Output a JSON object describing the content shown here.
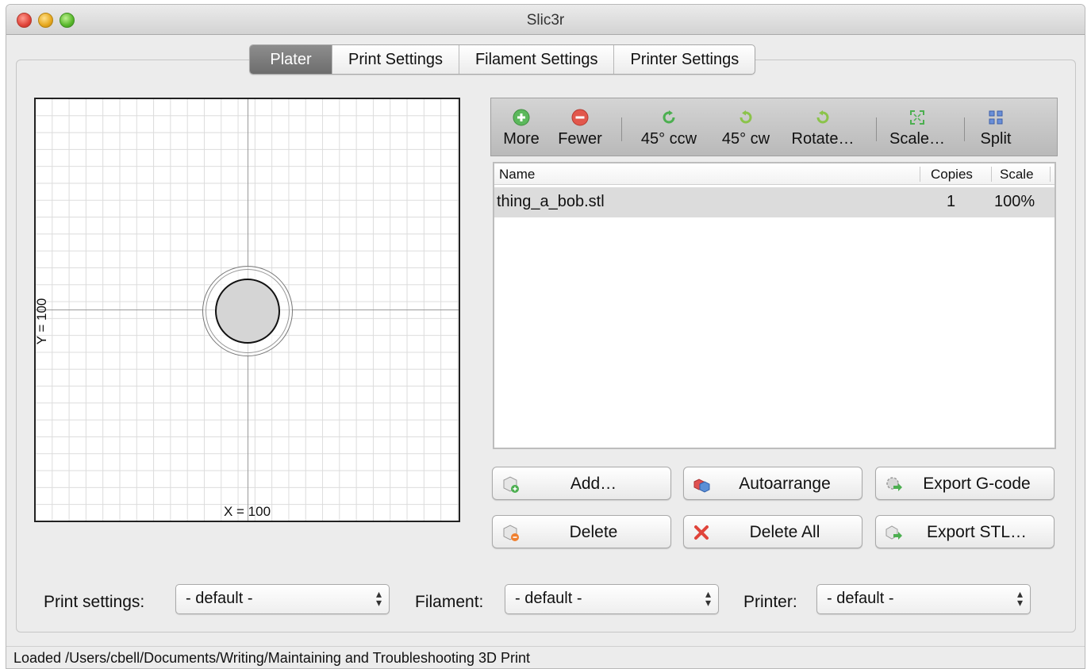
{
  "window": {
    "title": "Slic3r"
  },
  "tabs": [
    {
      "label": "Plater",
      "active": true
    },
    {
      "label": "Print Settings",
      "active": false
    },
    {
      "label": "Filament Settings",
      "active": false
    },
    {
      "label": "Printer Settings",
      "active": false
    }
  ],
  "plater": {
    "x_label": "X = 100",
    "y_label": "Y = 100"
  },
  "toolbar": {
    "more": "More",
    "fewer": "Fewer",
    "rotate_ccw": "45° ccw",
    "rotate_cw": "45° cw",
    "rotate": "Rotate…",
    "scale": "Scale…",
    "split": "Split"
  },
  "object_list": {
    "columns": {
      "name": "Name",
      "copies": "Copies",
      "scale": "Scale"
    },
    "rows": [
      {
        "name": "thing_a_bob.stl",
        "copies": "1",
        "scale": "100%"
      }
    ]
  },
  "buttons": {
    "add": "Add…",
    "autoarrange": "Autoarrange",
    "export_gcode": "Export G-code",
    "delete": "Delete",
    "delete_all": "Delete All",
    "export_stl": "Export STL…"
  },
  "presets": {
    "print_label": "Print settings:",
    "print_value": "- default -",
    "filament_label": "Filament:",
    "filament_value": "- default -",
    "printer_label": "Printer:",
    "printer_value": "- default -"
  },
  "status": {
    "text": "Loaded /Users/cbell/Documents/Writing/Maintaining and Troubleshooting 3D Print"
  },
  "colors": {
    "active_tab": "#7d7d7d",
    "selected_row": "#dcdcdc",
    "add_green": "#4caf50",
    "remove_red": "#e04b3c"
  }
}
